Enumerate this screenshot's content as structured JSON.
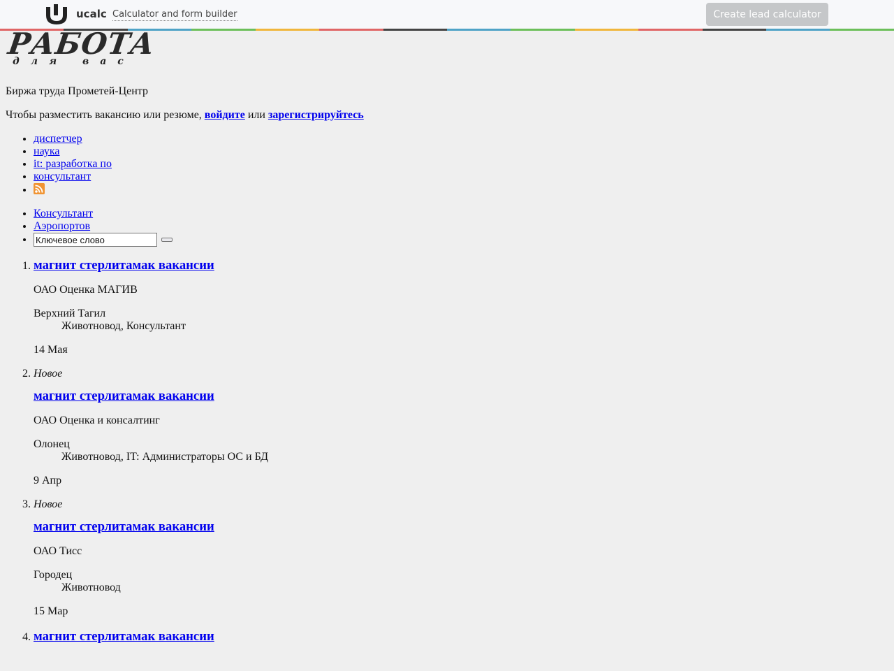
{
  "topbar": {
    "brand": "ucalc",
    "tagline": "Calculator and form builder",
    "cta_label": "Create lead calculator",
    "stripe_colors": [
      "#e06666",
      "#444444",
      "#4fa3c7",
      "#6cbf5a",
      "#f0b63c",
      "#e06666",
      "#444444",
      "#4fa3c7",
      "#6cbf5a",
      "#f0b63c",
      "#e06666",
      "#444444",
      "#4fa3c7",
      "#6cbf5a"
    ]
  },
  "logo": {
    "big": "РАБОТА",
    "small": "для вас"
  },
  "site_name": "Биржа труда Прометей-Центр",
  "login": {
    "prefix": "Чтобы разместить вакансию или резюме,",
    "login_link": "войдите",
    "or": "или",
    "register_link": "зарегистрируйтесь"
  },
  "tags": [
    "диспетчер",
    "наука",
    "it: разработка по",
    "консультант"
  ],
  "rss_icon": "rss-icon",
  "categories": [
    "Консультант",
    "Аэропортов"
  ],
  "search": {
    "placeholder": "Ключевое слово",
    "value": "Ключевое слово"
  },
  "jobs": [
    {
      "new_label": "",
      "title": "магнит стерлитамак вакансии",
      "company": "ОАО Оценка МАГИВ",
      "city": "Верхний Тагил",
      "specialties": "Животновод, Консультант",
      "date": "14 Мая"
    },
    {
      "new_label": "Новое",
      "title": "магнит стерлитамак вакансии",
      "company": "ОАО Оценка и консалтинг",
      "city": "Олонец",
      "specialties": "Животновод, IT: Администраторы ОС и БД",
      "date": "9 Апр"
    },
    {
      "new_label": "Новое",
      "title": "магнит стерлитамак вакансии",
      "company": "ОАО Тисс",
      "city": "Городец",
      "specialties": "Животновод",
      "date": "15 Мар"
    },
    {
      "new_label": "",
      "title": "магнит стерлитамак вакансии",
      "company": "",
      "city": "",
      "specialties": "",
      "date": ""
    }
  ]
}
